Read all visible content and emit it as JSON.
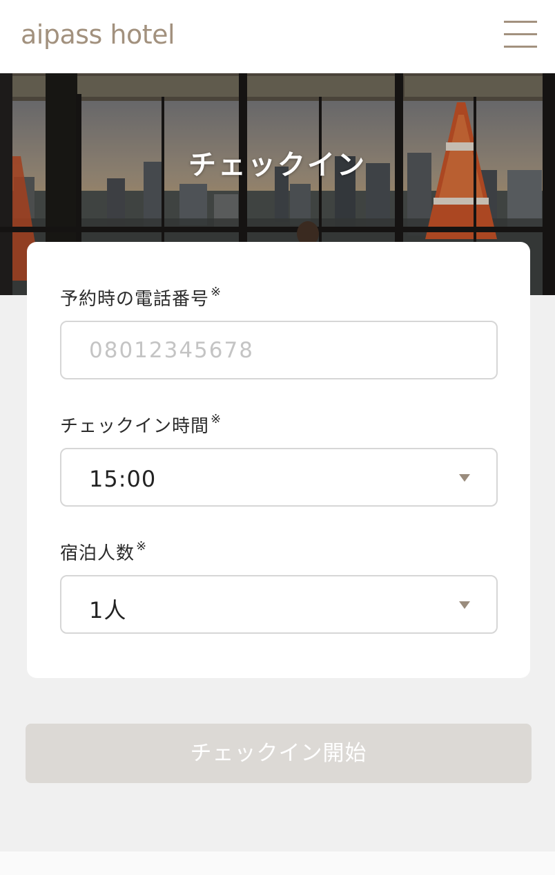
{
  "header": {
    "logo": "aipass hotel",
    "menu_icon": "hamburger-menu-icon"
  },
  "hero": {
    "title": "チェックイン"
  },
  "form": {
    "phone": {
      "label": "予約時の電話番号",
      "required_mark": "※",
      "placeholder": "08012345678",
      "value": ""
    },
    "checkin_time": {
      "label": "チェックイン時間",
      "required_mark": "※",
      "value": "15:00",
      "caret_icon": "caret-down-icon"
    },
    "guests": {
      "label": "宿泊人数",
      "required_mark": "※",
      "value": "1人",
      "caret_icon": "caret-down-icon"
    }
  },
  "submit": {
    "label": "チェックイン開始",
    "enabled": false
  },
  "colors": {
    "brand": "#a2917e",
    "button_disabled": "#dcd9d5",
    "background": "#f0f0f0"
  }
}
